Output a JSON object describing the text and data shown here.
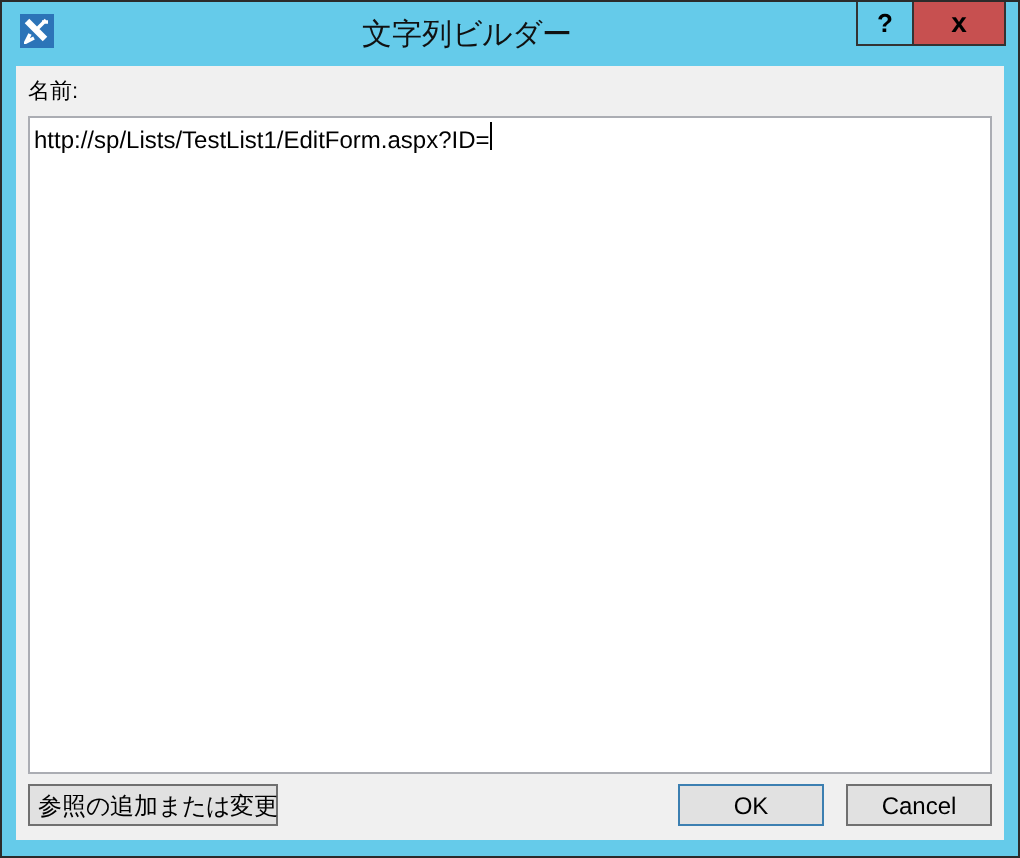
{
  "window": {
    "title": "文字列ビルダー",
    "help_button": "?",
    "close_button": "x"
  },
  "name_field": {
    "label": "名前:",
    "value": "http://sp/Lists/TestList1/EditForm.aspx?ID=",
    "focused": true
  },
  "buttons": [
    {
      "label": "参照の追加または変更",
      "default": false
    },
    {
      "label": "OK",
      "default": true
    },
    {
      "label": "Cancel",
      "default": false
    }
  ]
}
